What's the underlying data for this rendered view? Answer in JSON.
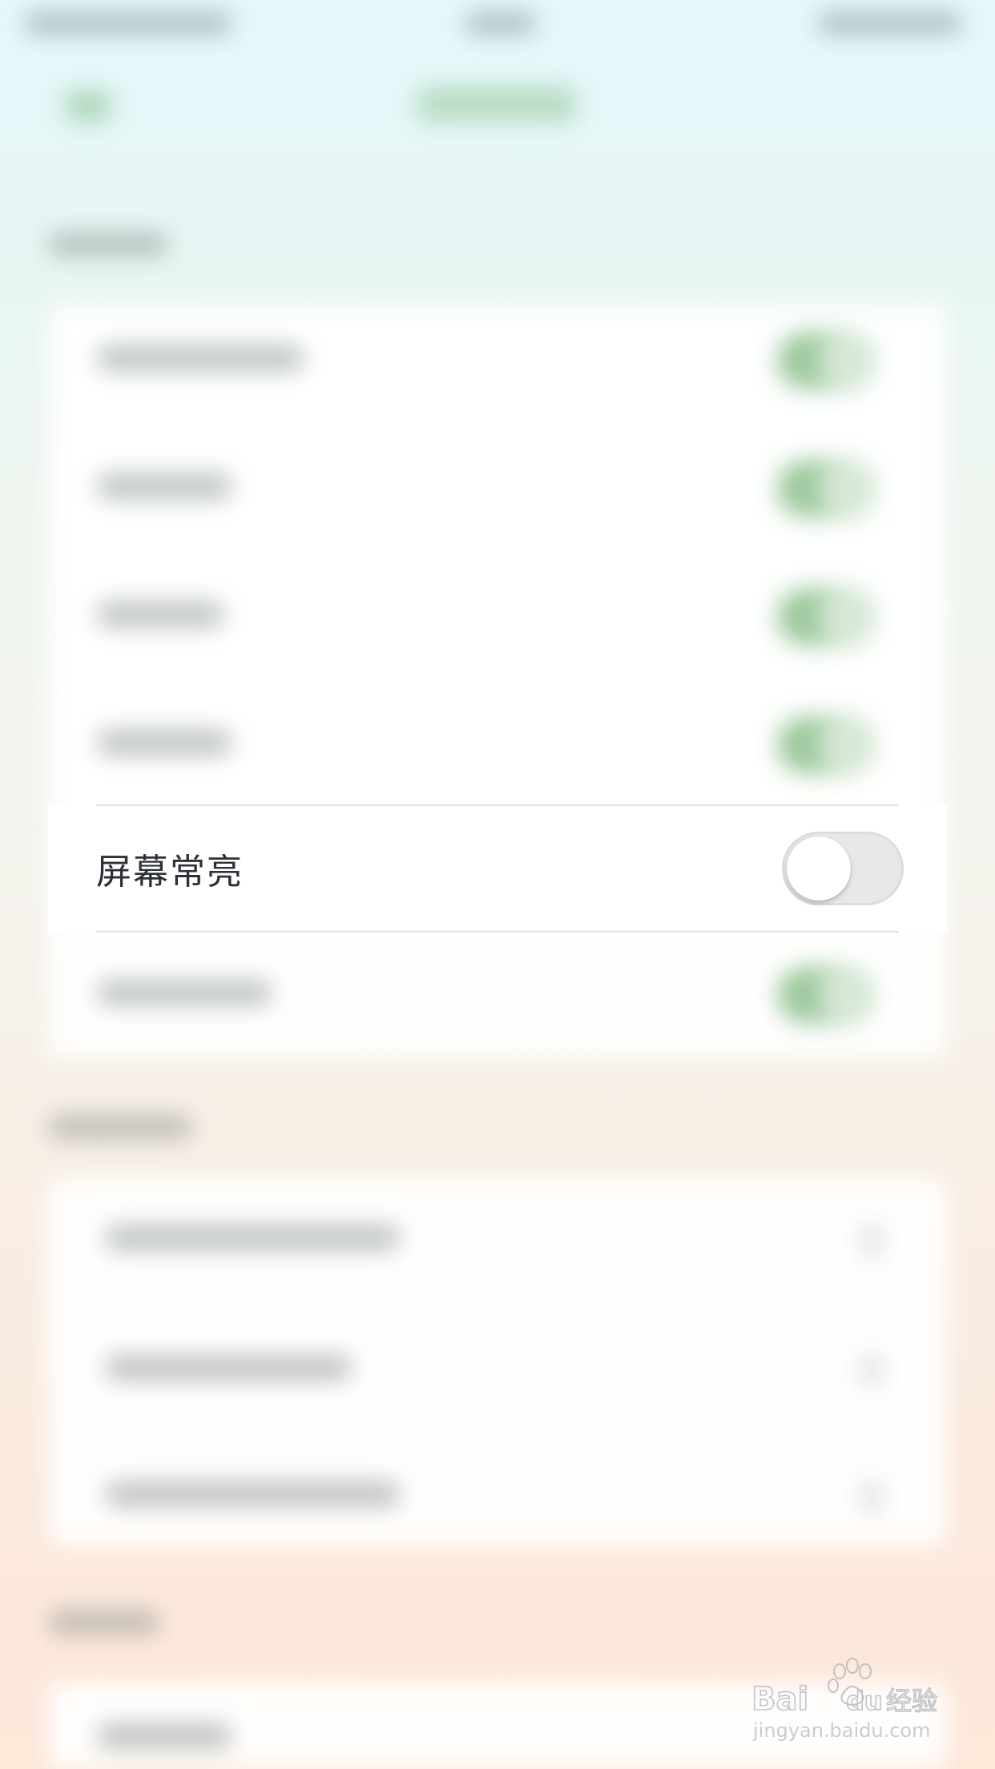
{
  "focused_row": {
    "label": "屏幕常亮",
    "toggle_state": "off"
  },
  "watermark": {
    "logo_text": "Bai du 经验",
    "url_text": "jingyan.baidu.com"
  },
  "colors": {
    "toggle_off_track": "#e8e8ea",
    "toggle_on_blurred": "#8cbe8c",
    "label_text": "#2c3138"
  }
}
